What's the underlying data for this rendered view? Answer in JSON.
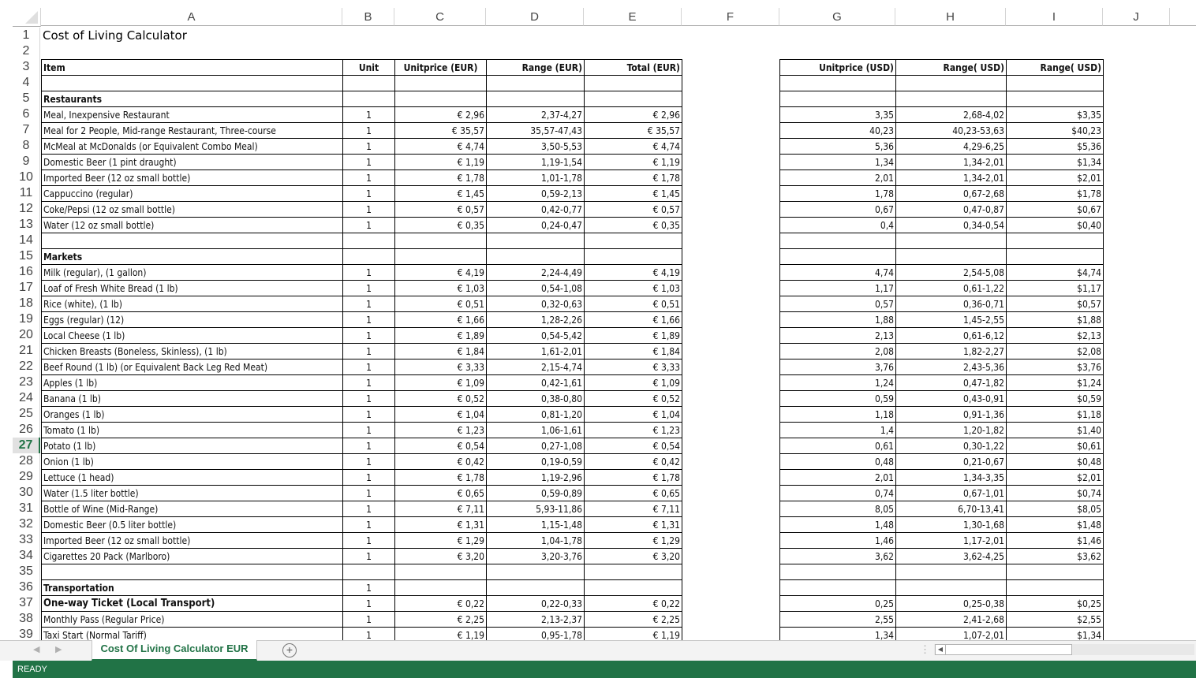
{
  "columns": [
    "A",
    "B",
    "C",
    "D",
    "E",
    "F",
    "G",
    "H",
    "I",
    "J"
  ],
  "active_row": 27,
  "title": "Cost of Living Calculator",
  "headers": {
    "item": "Item",
    "unit": "Unit",
    "unitprice_eur": "Unitprice (EUR)",
    "range_eur": "Range (EUR)",
    "total_eur": "Total (EUR)",
    "unitprice_usd": "Unitprice (USD)",
    "range_usd_1": "Range( USD)",
    "range_usd_2": "Range( USD)"
  },
  "rows": [
    {
      "row": 4,
      "item": "",
      "unit": "",
      "c": "",
      "d": "",
      "e": "",
      "g": "",
      "h": "",
      "i": ""
    },
    {
      "row": 5,
      "item": "Restaurants",
      "bold": true,
      "unit": "",
      "c": "",
      "d": "",
      "e": "",
      "g": "",
      "h": "",
      "i": ""
    },
    {
      "row": 6,
      "item": "Meal, Inexpensive Restaurant",
      "unit": "1",
      "c": "€ 2,96",
      "d": "2,37-4,27",
      "e": "€ 2,96",
      "g": "3,35",
      "h": "2,68-4,02",
      "i": "$3,35"
    },
    {
      "row": 7,
      "item": "Meal for 2 People, Mid-range Restaurant, Three-course",
      "unit": "1",
      "c": "€ 35,57",
      "d": "35,57-47,43",
      "e": "€ 35,57",
      "g": "40,23",
      "h": "40,23-53,63",
      "i": "$40,23"
    },
    {
      "row": 8,
      "item": "McMeal at McDonalds (or Equivalent Combo Meal)",
      "unit": "1",
      "c": "€ 4,74",
      "d": "3,50-5,53",
      "e": "€ 4,74",
      "g": "5,36",
      "h": "4,29-6,25",
      "i": "$5,36"
    },
    {
      "row": 9,
      "item": "Domestic Beer (1 pint draught)",
      "unit": "1",
      "c": "€ 1,19",
      "d": "1,19-1,54",
      "e": "€ 1,19",
      "g": "1,34",
      "h": "1,34-2,01",
      "i": "$1,34"
    },
    {
      "row": 10,
      "item": "Imported Beer (12 oz small bottle)",
      "unit": "1",
      "c": "€ 1,78",
      "d": "1,01-1,78",
      "e": "€ 1,78",
      "g": "2,01",
      "h": "1,34-2,01",
      "i": "$2,01"
    },
    {
      "row": 11,
      "item": "Cappuccino (regular)",
      "unit": "1",
      "c": "€ 1,45",
      "d": "0,59-2,13",
      "e": "€ 1,45",
      "g": "1,78",
      "h": "0,67-2,68",
      "i": "$1,78"
    },
    {
      "row": 12,
      "item": "Coke/Pepsi (12 oz small bottle)",
      "unit": "1",
      "c": "€ 0,57",
      "d": "0,42-0,77",
      "e": "€ 0,57",
      "g": "0,67",
      "h": "0,47-0,87",
      "i": "$0,67"
    },
    {
      "row": 13,
      "item": "Water (12 oz small bottle)",
      "unit": "1",
      "c": "€ 0,35",
      "d": "0,24-0,47",
      "e": "€ 0,35",
      "g": "0,4",
      "h": "0,34-0,54",
      "i": "$0,40"
    },
    {
      "row": 14,
      "item": "",
      "unit": "",
      "c": "",
      "d": "",
      "e": "",
      "g": "",
      "h": "",
      "i": ""
    },
    {
      "row": 15,
      "item": "Markets",
      "bold": true,
      "unit": "",
      "c": "",
      "d": "",
      "e": "",
      "g": "",
      "h": "",
      "i": ""
    },
    {
      "row": 16,
      "item": "Milk (regular), (1 gallon)",
      "unit": "1",
      "c": "€ 4,19",
      "d": "2,24-4,49",
      "e": "€ 4,19",
      "g": "4,74",
      "h": "2,54-5,08",
      "i": "$4,74"
    },
    {
      "row": 17,
      "item": "Loaf of Fresh White Bread (1 lb)",
      "unit": "1",
      "c": "€ 1,03",
      "d": "0,54-1,08",
      "e": "€ 1,03",
      "g": "1,17",
      "h": "0,61-1,22",
      "i": "$1,17"
    },
    {
      "row": 18,
      "item": "Rice (white), (1 lb)",
      "unit": "1",
      "c": "€ 0,51",
      "d": "0,32-0,63",
      "e": "€ 0,51",
      "g": "0,57",
      "h": "0,36-0,71",
      "i": "$0,57"
    },
    {
      "row": 19,
      "item": "Eggs (regular) (12)",
      "unit": "1",
      "c": "€ 1,66",
      "d": "1,28-2,26",
      "e": "€ 1,66",
      "g": "1,88",
      "h": "1,45-2,55",
      "i": "$1,88"
    },
    {
      "row": 20,
      "item": "Local Cheese (1 lb)",
      "unit": "1",
      "c": "€ 1,89",
      "d": "0,54-5,42",
      "e": "€ 1,89",
      "g": "2,13",
      "h": "0,61-6,12",
      "i": "$2,13"
    },
    {
      "row": 21,
      "item": "Chicken Breasts (Boneless, Skinless), (1 lb)",
      "unit": "1",
      "c": "€ 1,84",
      "d": "1,61-2,01",
      "e": "€ 1,84",
      "g": "2,08",
      "h": "1,82-2,27",
      "i": "$2,08"
    },
    {
      "row": 22,
      "item": "Beef Round (1 lb) (or Equivalent Back Leg Red Meat)",
      "unit": "1",
      "c": "€ 3,33",
      "d": "2,15-4,74",
      "e": "€ 3,33",
      "g": "3,76",
      "h": "2,43-5,36",
      "i": "$3,76"
    },
    {
      "row": 23,
      "item": "Apples (1 lb)",
      "unit": "1",
      "c": "€ 1,09",
      "d": "0,42-1,61",
      "e": "€ 1,09",
      "g": "1,24",
      "h": "0,47-1,82",
      "i": "$1,24"
    },
    {
      "row": 24,
      "item": "Banana (1 lb)",
      "unit": "1",
      "c": "€ 0,52",
      "d": "0,38-0,80",
      "e": "€ 0,52",
      "g": "0,59",
      "h": "0,43-0,91",
      "i": "$0,59"
    },
    {
      "row": 25,
      "item": "Oranges (1 lb)",
      "unit": "1",
      "c": "€ 1,04",
      "d": "0,81-1,20",
      "e": "€ 1,04",
      "g": "1,18",
      "h": "0,91-1,36",
      "i": "$1,18"
    },
    {
      "row": 26,
      "item": "Tomato (1 lb)",
      "unit": "1",
      "c": "€ 1,23",
      "d": "1,06-1,61",
      "e": "€ 1,23",
      "g": "1,4",
      "h": "1,20-1,82",
      "i": "$1,40"
    },
    {
      "row": 27,
      "item": "Potato (1 lb)",
      "unit": "1",
      "c": "€ 0,54",
      "d": "0,27-1,08",
      "e": "€ 0,54",
      "g": "0,61",
      "h": "0,30-1,22",
      "i": "$0,61"
    },
    {
      "row": 28,
      "item": "Onion (1 lb)",
      "unit": "1",
      "c": "€ 0,42",
      "d": "0,19-0,59",
      "e": "€ 0,42",
      "g": "0,48",
      "h": "0,21-0,67",
      "i": "$0,48"
    },
    {
      "row": 29,
      "item": "Lettuce (1 head)",
      "unit": "1",
      "c": "€ 1,78",
      "d": "1,19-2,96",
      "e": "€ 1,78",
      "g": "2,01",
      "h": "1,34-3,35",
      "i": "$2,01"
    },
    {
      "row": 30,
      "item": "Water (1.5 liter bottle)",
      "unit": "1",
      "c": "€ 0,65",
      "d": "0,59-0,89",
      "e": "€ 0,65",
      "g": "0,74",
      "h": "0,67-1,01",
      "i": "$0,74"
    },
    {
      "row": 31,
      "item": "Bottle of Wine (Mid-Range)",
      "unit": "1",
      "c": "€ 7,11",
      "d": "5,93-11,86",
      "e": "€ 7,11",
      "g": "8,05",
      "h": "6,70-13,41",
      "i": "$8,05"
    },
    {
      "row": 32,
      "item": "Domestic Beer (0.5 liter bottle)",
      "unit": "1",
      "c": "€ 1,31",
      "d": "1,15-1,48",
      "e": "€ 1,31",
      "g": "1,48",
      "h": "1,30-1,68",
      "i": "$1,48"
    },
    {
      "row": 33,
      "item": "Imported Beer (12 oz small bottle)",
      "unit": "1",
      "c": "€ 1,29",
      "d": "1,04-1,78",
      "e": "€ 1,29",
      "g": "1,46",
      "h": "1,17-2,01",
      "i": "$1,46"
    },
    {
      "row": 34,
      "item": "Cigarettes 20 Pack (Marlboro)",
      "unit": "1",
      "c": "€ 3,20",
      "d": "3,20-3,76",
      "e": "€ 3,20",
      "g": "3,62",
      "h": "3,62-4,25",
      "i": "$3,62"
    },
    {
      "row": 35,
      "item": "",
      "unit": "",
      "c": "",
      "d": "",
      "e": "",
      "g": "",
      "h": "",
      "i": ""
    },
    {
      "row": 36,
      "item": "Transportation",
      "bold": true,
      "unit": "1",
      "c": "",
      "d": "",
      "e": "",
      "g": "",
      "h": "",
      "i": ""
    },
    {
      "row": 37,
      "item": "One-way Ticket (Local Transport)",
      "bold": true,
      "large": true,
      "unit": "1",
      "c": "€ 0,22",
      "d": "0,22-0,33",
      "e": "€ 0,22",
      "g": "0,25",
      "h": "0,25-0,38",
      "i": "$0,25"
    },
    {
      "row": 38,
      "item": "Monthly Pass (Regular Price)",
      "unit": "1",
      "c": "€ 2,25",
      "d": "2,13-2,37",
      "e": "€ 2,25",
      "g": "2,55",
      "h": "2,41-2,68",
      "i": "$2,55"
    },
    {
      "row": 39,
      "item": "Taxi Start (Normal Tariff)",
      "unit": "1",
      "c": "€ 1,19",
      "d": "0,95-1,78",
      "e": "€ 1,19",
      "g": "1,34",
      "h": "1,07-2,01",
      "i": "$1,34"
    }
  ],
  "sheet_tabs": [
    {
      "label": "Cost Of Living Calculator EUR",
      "active": true
    }
  ],
  "add_sheet_icon": "plus-circle-icon",
  "status": "READY",
  "colors": {
    "accent": "#217346"
  }
}
